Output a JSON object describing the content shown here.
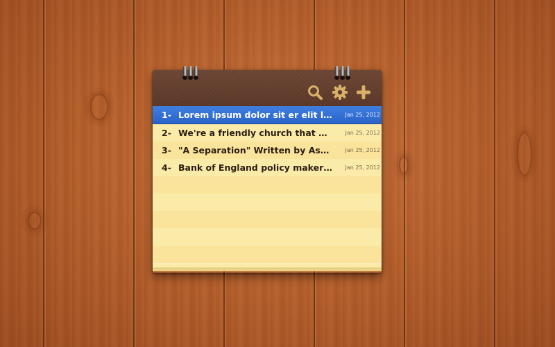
{
  "toolbar": {
    "icons": [
      "search-icon",
      "gear-icon",
      "plus-icon"
    ],
    "icon_color": "#d9b06a"
  },
  "notes": [
    {
      "number": "1-",
      "title": "Lorem ipsum dolor sit er elit lamet, ...",
      "date": "Jan 25, 2012",
      "selected": true
    },
    {
      "number": "2-",
      "title": "We're a friendly church that woul...",
      "date": "Jan 25, 2012",
      "selected": false
    },
    {
      "number": "3-",
      "title": "\"A Separation\" Written by Asghar F...",
      "date": "Jan 25, 2012",
      "selected": false
    },
    {
      "number": "4-",
      "title": "Bank of England policy makers vote...",
      "date": "Jan 25, 2012",
      "selected": false
    }
  ],
  "colors": {
    "selection": "#2f6fd6",
    "paper": "#fbeaa8",
    "cover": "#5f3b2b"
  }
}
